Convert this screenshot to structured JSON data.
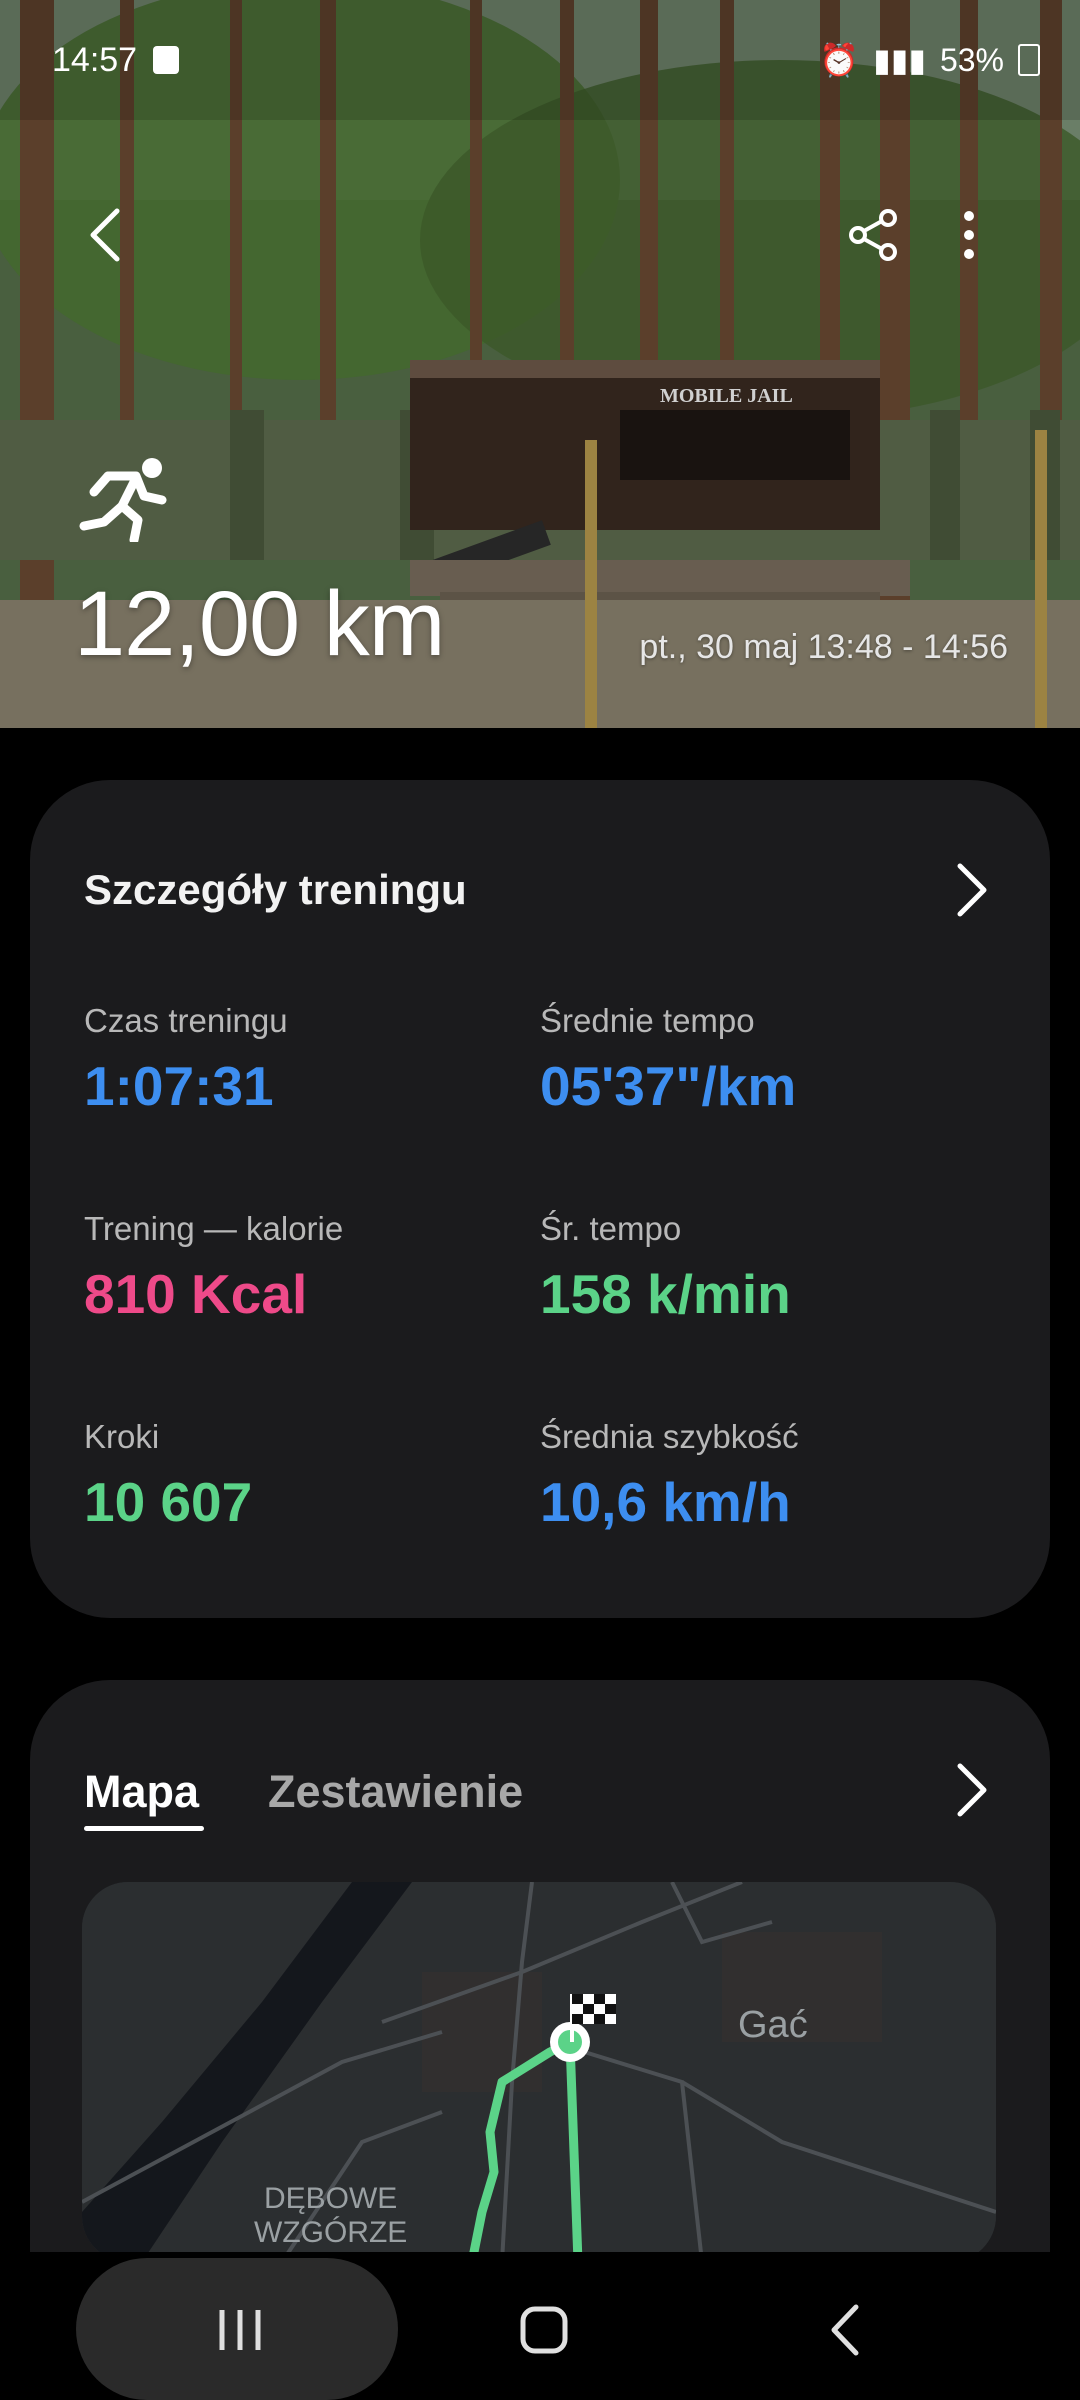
{
  "status": {
    "time": "14:57",
    "battery": "53%"
  },
  "hero": {
    "distance": "12,00 km",
    "datetime": "pt., 30 maj 13:48 - 14:56",
    "sign_text": "MOBILE  JAIL"
  },
  "details": {
    "title": "Szczegóły treningu",
    "stats": [
      {
        "label": "Czas treningu",
        "value": "1:07:31",
        "color": "#3d8ef0"
      },
      {
        "label": "Średnie tempo",
        "value": "05'37\"/km",
        "color": "#3d8ef0"
      },
      {
        "label": "Trening — kalorie",
        "value": "810 Kcal",
        "color": "#ee4a89"
      },
      {
        "label": "Śr. tempo",
        "value": "158 k/min",
        "color": "#5bd388"
      },
      {
        "label": "Kroki",
        "value": "10 607",
        "color": "#5bd388"
      },
      {
        "label": "Średnia szybkość",
        "value": "10,6 km/h",
        "color": "#3d8ef0"
      }
    ]
  },
  "map_section": {
    "tabs": [
      {
        "label": "Mapa",
        "active": true
      },
      {
        "label": "Zestawienie",
        "active": false
      }
    ],
    "map_labels": {
      "town": "Gać",
      "area_line1": "DĘBOWE",
      "area_line2": "WZGÓRZE"
    }
  },
  "icons": {
    "back": "back-arrow-icon",
    "share": "share-icon",
    "more": "more-vert-icon",
    "runner": "running-icon",
    "chevron": "chevron-right-icon",
    "flag": "finish-flag-icon",
    "nav_recents": "recents-icon",
    "nav_home": "home-icon",
    "nav_back": "nav-back-icon"
  }
}
